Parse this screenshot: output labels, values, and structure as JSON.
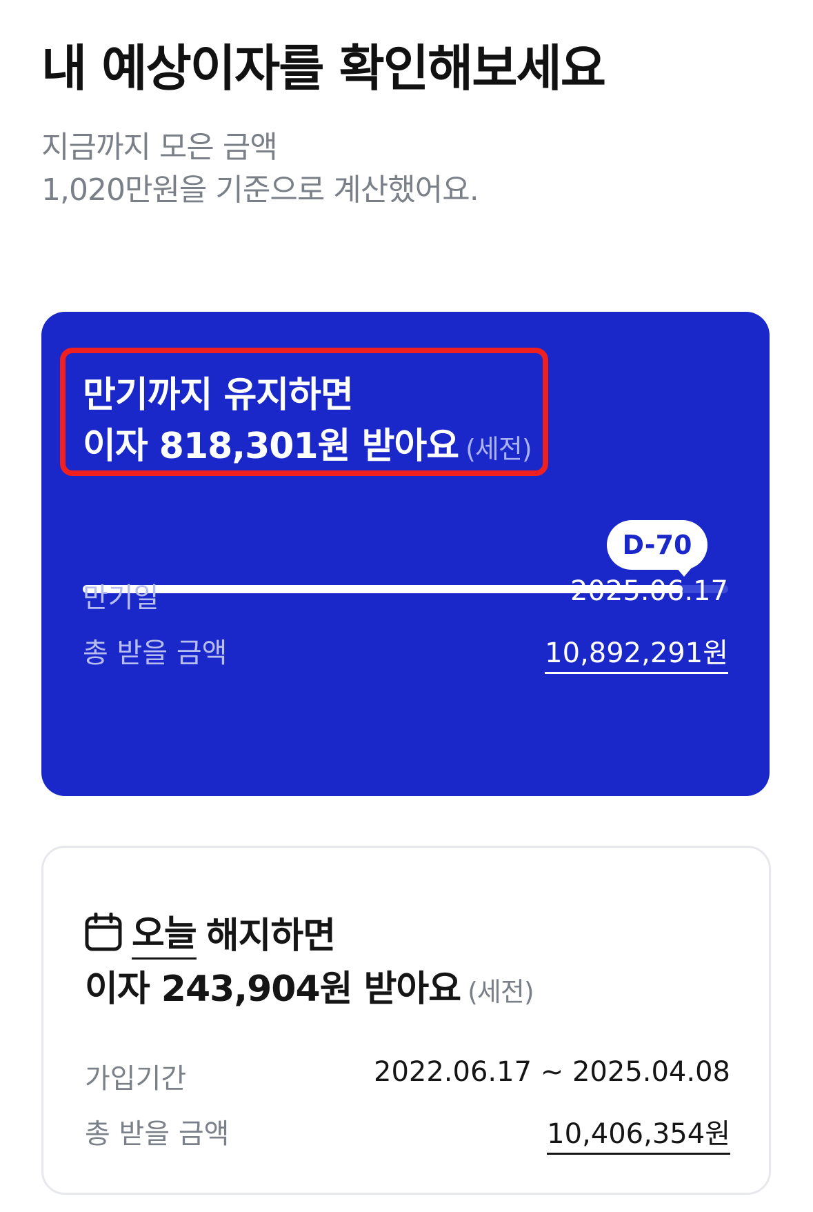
{
  "page": {
    "title": "내 예상이자를 확인해보세요",
    "subtitle_line1": "지금까지 모은 금액",
    "subtitle_line2": "1,020만원을 기준으로 계산했어요."
  },
  "maturity_card": {
    "line1": "만기까지 유지하면",
    "line2": "이자 818,301원 받아요",
    "tax_note": "(세전)",
    "dday_label": "D-70",
    "progress_fraction": 0.93,
    "maturity_date_label": "만기일",
    "maturity_date_value": "2025.06.17",
    "total_label": "총 받을 금액",
    "total_value": "10,892,291원",
    "highlight_color": "#f02020",
    "background_color": "#1b28c9"
  },
  "cancel_card": {
    "today_word": "오늘",
    "line1_rest": "해지하면",
    "line2": "이자 243,904원 받아요",
    "tax_note": "(세전)",
    "period_label": "가입기간",
    "period_value": "2022.06.17 ~ 2025.04.08",
    "total_label": "총 받을 금액",
    "total_value": "10,406,354원",
    "icon": "calendar-icon"
  }
}
